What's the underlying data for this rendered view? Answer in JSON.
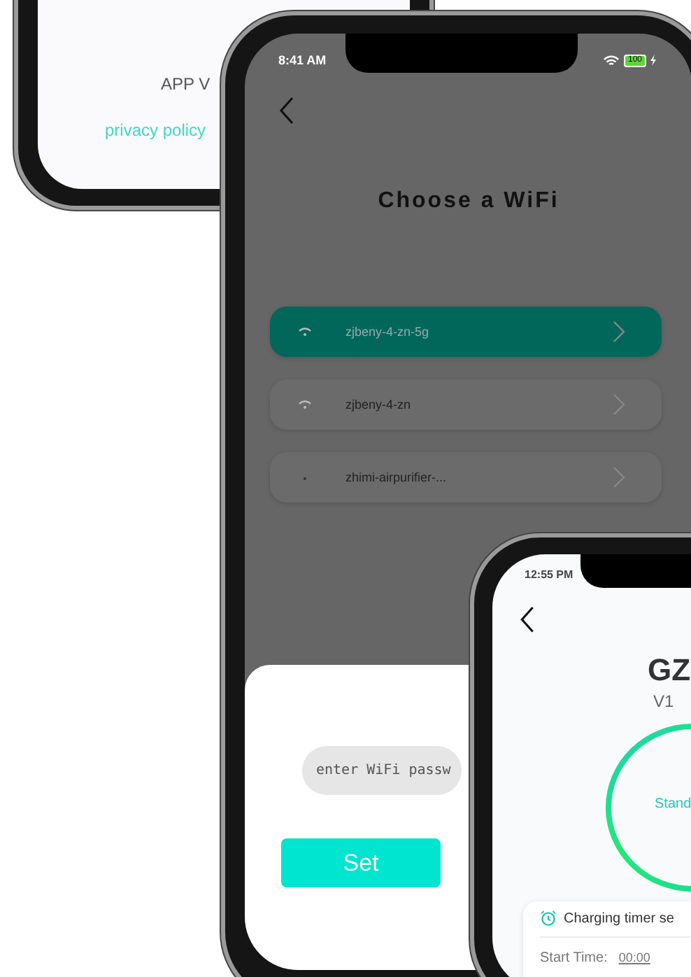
{
  "left_phone": {
    "app_version_label": "APP V",
    "privacy_link": "privacy policy"
  },
  "wifi_screen": {
    "status_bar": {
      "time": "8:41 AM",
      "battery": "100"
    },
    "title": "Choose a WiFi",
    "networks": [
      {
        "name": "zjbeny-4-zn-5g",
        "selected": true,
        "kind": "wifi"
      },
      {
        "name": "zjbeny-4-zn",
        "selected": false,
        "kind": "wifi"
      },
      {
        "name": "zhimi-airpurifier-...",
        "selected": false,
        "kind": "dot"
      }
    ],
    "password_field": {
      "placeholder": "enter WiFi passw"
    },
    "set_button": "Set"
  },
  "device_screen": {
    "status_bar": {
      "time": "12:55 PM"
    },
    "device_name": "GZ",
    "version": "V1",
    "status": "Stand",
    "timer_card": {
      "title": "Charging timer se",
      "start_label": "Start Time:",
      "start_value": "00:00"
    }
  }
}
